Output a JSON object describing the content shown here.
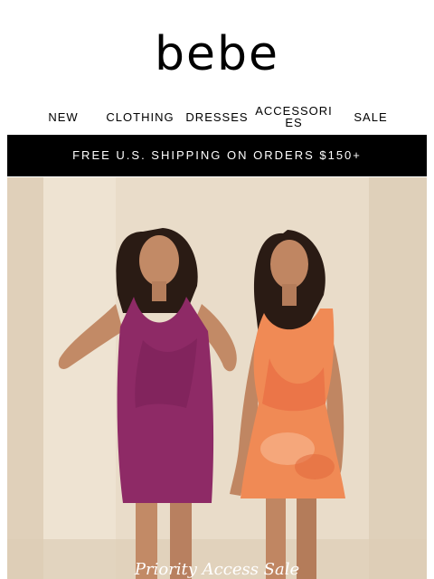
{
  "brand": {
    "logo_text": "bebe"
  },
  "nav": {
    "items": [
      {
        "label": "NEW"
      },
      {
        "label": "CLOTHING"
      },
      {
        "label": "DRESSES"
      },
      {
        "label": "ACCESSORIES"
      },
      {
        "label": "SALE"
      }
    ]
  },
  "banner": {
    "text": "FREE U.S. SHIPPING ON ORDERS $150+"
  },
  "hero": {
    "caption": "Priority Access Sale",
    "colors": {
      "backdrop": "#e8dbc8",
      "magenta_dress": "#8e2a66",
      "orange_dress": "#f08a55",
      "skin": "#c28a66",
      "hair": "#2a1b14"
    }
  }
}
